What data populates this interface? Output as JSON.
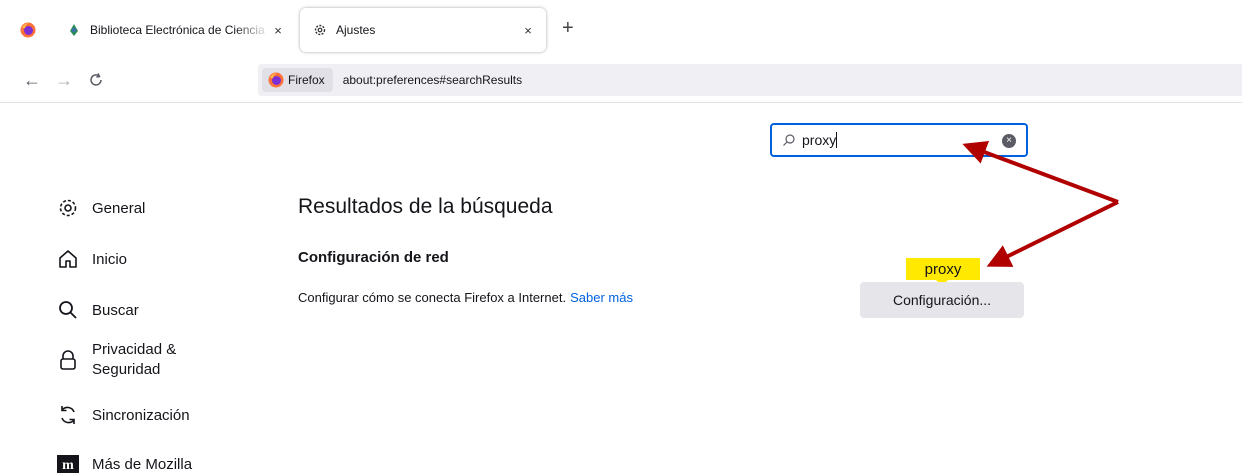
{
  "tabs": [
    {
      "label": "Biblioteca Electrónica de Ciencia",
      "close": "×",
      "icon": "globe-icon"
    },
    {
      "label": "Ajustes",
      "close": "×",
      "icon": "gear-icon"
    }
  ],
  "new_tab": "+",
  "nav": {
    "back": "←",
    "forward": "→",
    "reload": "C",
    "identity_label": "Firefox",
    "url": "about:preferences#searchResults"
  },
  "search": {
    "value": "proxy",
    "clear": "×"
  },
  "sidebar": {
    "items": [
      {
        "label": "General",
        "icon": "gear-icon"
      },
      {
        "label": "Inicio",
        "icon": "home-icon"
      },
      {
        "label": "Buscar",
        "icon": "search-icon"
      },
      {
        "label_line1": "Privacidad &",
        "label_line2": "Seguridad",
        "icon": "lock-icon"
      },
      {
        "label": "Sincronización",
        "icon": "sync-icon"
      },
      {
        "label": "Más de Mozilla",
        "icon": "mozilla-icon"
      }
    ]
  },
  "main": {
    "results_title": "Resultados de la búsqueda",
    "section_title": "Configuración de red",
    "description": "Configurar cómo se conecta Firefox a Internet.",
    "learn_more": "Saber más",
    "settings_button": "Configuración...",
    "highlight_label": "proxy"
  },
  "colors": {
    "accent": "#0061e0",
    "highlight": "#ffe900",
    "annotation_arrow": "#b00000"
  }
}
